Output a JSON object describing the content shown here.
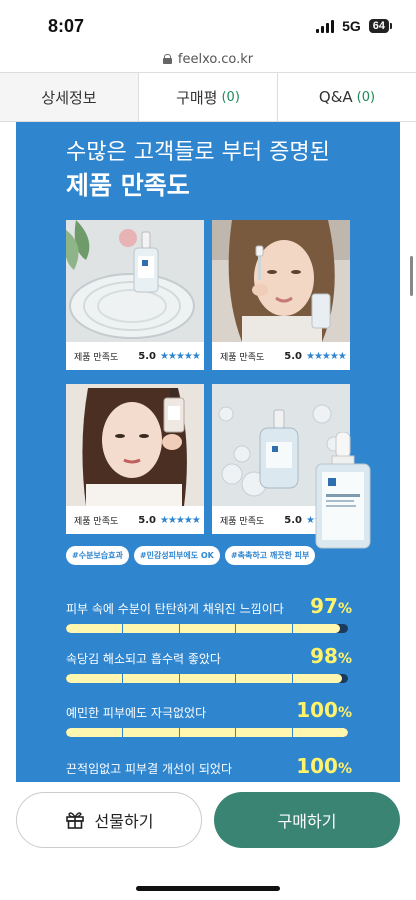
{
  "status": {
    "time": "8:07",
    "network": "5G",
    "battery": "64"
  },
  "browser": {
    "url": "feelxo.co.kr"
  },
  "tabs": [
    {
      "label": "상세정보",
      "count": ""
    },
    {
      "label": "구매평",
      "count": "(0)"
    },
    {
      "label": "Q&A",
      "count": "(0)"
    }
  ],
  "banner": {
    "headline_line1": "수많은 고객들로 부터 증명된",
    "headline_line2": "제품 만족도",
    "cards": [
      {
        "label": "제품 만족도",
        "score": "5.0",
        "stars": "★★★★★"
      },
      {
        "label": "제품 만족도",
        "score": "5.0",
        "stars": "★★★★★"
      },
      {
        "label": "제품 만족도",
        "score": "5.0",
        "stars": "★★★★★"
      },
      {
        "label": "제품 만족도",
        "score": "5.0",
        "stars": "★★★★"
      }
    ],
    "tags": [
      "#수분보습효과",
      "#민감성피부에도 OK",
      "#촉촉하고 깨끗한 피부"
    ],
    "metrics": [
      {
        "label": "피부 속에 수분이 탄탄하게 채워진 느낌이다",
        "value": "97",
        "unit": "%",
        "fraction": 0.97
      },
      {
        "label": "속당김 해소되고 흡수력 좋았다",
        "value": "98",
        "unit": "%",
        "fraction": 0.98
      },
      {
        "label": "예민한 피부에도 자극없었다",
        "value": "100",
        "unit": "%",
        "fraction": 1.0
      },
      {
        "label": "끈적임없고 피부결 개선이 되었다",
        "value": "100",
        "unit": "%",
        "fraction": 1.0
      }
    ]
  },
  "actions": {
    "gift_label": "선물하기",
    "buy_label": "구매하기"
  },
  "colors": {
    "banner_blue": "#2f86cf",
    "accent_yellow": "#fff36b",
    "buy_green": "#3a8474",
    "tab_count_green": "#1e8a5a"
  }
}
